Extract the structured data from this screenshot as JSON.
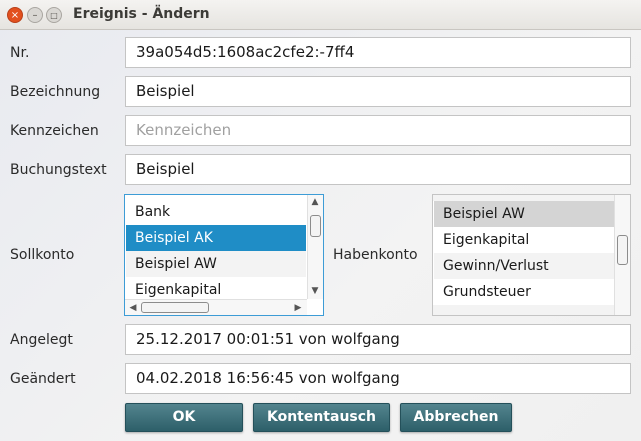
{
  "window": {
    "title": "Ereignis - Ändern",
    "close_glyph": "×",
    "min_glyph": "–",
    "max_glyph": "□"
  },
  "form": {
    "nr": {
      "label": "Nr.",
      "value": "39a054d5:1608ac2cfe2:-7ff4"
    },
    "bezeichnung": {
      "label": "Bezeichnung",
      "value": "Beispiel"
    },
    "kennzeichen": {
      "label": "Kennzeichen",
      "value": "",
      "placeholder": "Kennzeichen"
    },
    "buchungstext": {
      "label": "Buchungstext",
      "value": "Beispiel"
    },
    "sollkonto": {
      "label": "Sollkonto",
      "items": [
        "Bank",
        "Beispiel AK",
        "Beispiel AW",
        "Eigenkapital"
      ],
      "selected": "Beispiel AK"
    },
    "habenkonto": {
      "label": "Habenkonto",
      "items": [
        "Beispiel AW",
        "Eigenkapital",
        "Gewinn/Verlust",
        "Grundsteuer"
      ],
      "selected": "Beispiel AW"
    },
    "angelegt": {
      "label": "Angelegt",
      "value": "25.12.2017 00:01:51 von wolfgang"
    },
    "geaendert": {
      "label": "Geändert",
      "value": "04.02.2018 16:56:45 von wolfgang"
    }
  },
  "buttons": {
    "ok": "OK",
    "kontentausch": "Kontentausch",
    "abbrechen": "Abbrechen"
  },
  "colors": {
    "selection_blue": "#1f8dc6",
    "selection_gray": "#d4d4d4",
    "button_teal": "#3e6f79",
    "focus_border": "#3d9cd6"
  },
  "icons": {
    "scroll_up": "▲",
    "scroll_down": "▼",
    "scroll_left": "◀",
    "scroll_right": "▶"
  }
}
